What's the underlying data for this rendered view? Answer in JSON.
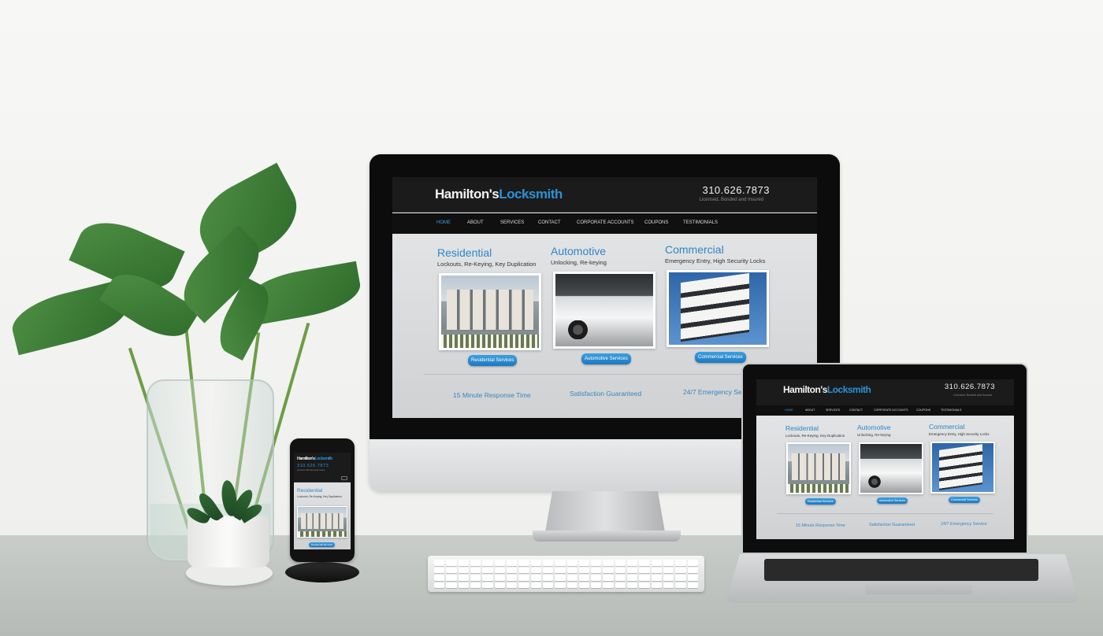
{
  "site": {
    "brand_first": "Hamilton's",
    "brand_second": "Locksmith",
    "phone": "310.626.7873",
    "tagline": "Licensed, Bonded and Insured",
    "nav": [
      "Home",
      "About",
      "Services",
      "Contact",
      "Corporate Accounts",
      "Coupons",
      "Testimonials"
    ],
    "active_nav": "Home",
    "sections": [
      {
        "title": "Residential",
        "subtitle": "Lockouts, Re-Keying, Key Duplication",
        "button": "Residential Services",
        "image": "townhouses-photo"
      },
      {
        "title": "Automotive",
        "subtitle": "Unlocking, Re-keying",
        "button": "Automotive Services",
        "image": "white-car-photo"
      },
      {
        "title": "Commercial",
        "subtitle": "Emergency Entry, High Security Locks",
        "button": "Commercial Services",
        "image": "office-building-photo"
      }
    ],
    "features_imac": [
      "15 Minute Response Time",
      "Satisfaction Guaranteed",
      "24/7 Emergency Se"
    ],
    "features": [
      "15 Minute Response Time",
      "Satisfaction Guaranteed",
      "24/7 Emergency Service"
    ],
    "phone_subtitle": "Lockouts, Re-Keying, Key Duplication"
  },
  "colors": {
    "accent_blue": "#2c91d5",
    "header_dark": "#1b1b1b",
    "nav_dark": "#101010",
    "button_blue": "#1f78bf"
  }
}
